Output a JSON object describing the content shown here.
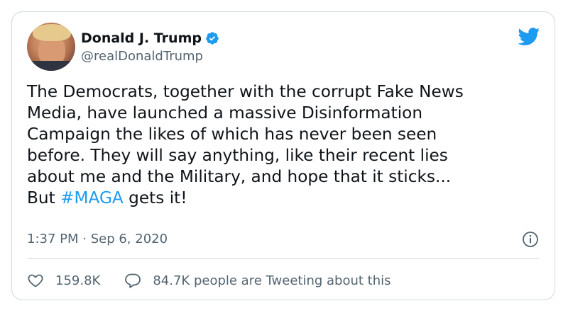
{
  "tweet": {
    "author": {
      "display_name": "Donald J. Trump",
      "handle": "@realDonaldTrump",
      "verified": true,
      "avatar_icon": "profile-photo"
    },
    "text_before_hashtag": "The Democrats, together with the corrupt Fake News\nMedia, have launched a massive Disinformation\nCampaign the likes of which has never been seen\nbefore. They will say anything, like their recent lies\nabout me and the Military, and hope that it sticks...\nBut ",
    "hashtag": "#MAGA",
    "text_after_hashtag": " gets it!",
    "timestamp": "1:37 PM · Sep 6, 2020",
    "likes": "159.8K",
    "replies_label": "84.7K people are Tweeting about this"
  },
  "icons": {
    "brand": "twitter-bird-icon",
    "verified": "verified-badge-icon",
    "info": "info-icon",
    "like": "heart-icon",
    "reply": "speech-bubble-icon"
  },
  "colors": {
    "brand_blue": "#1d9bf0",
    "text_primary": "#0f1419",
    "text_secondary": "#536471",
    "border": "#cfd9de"
  }
}
